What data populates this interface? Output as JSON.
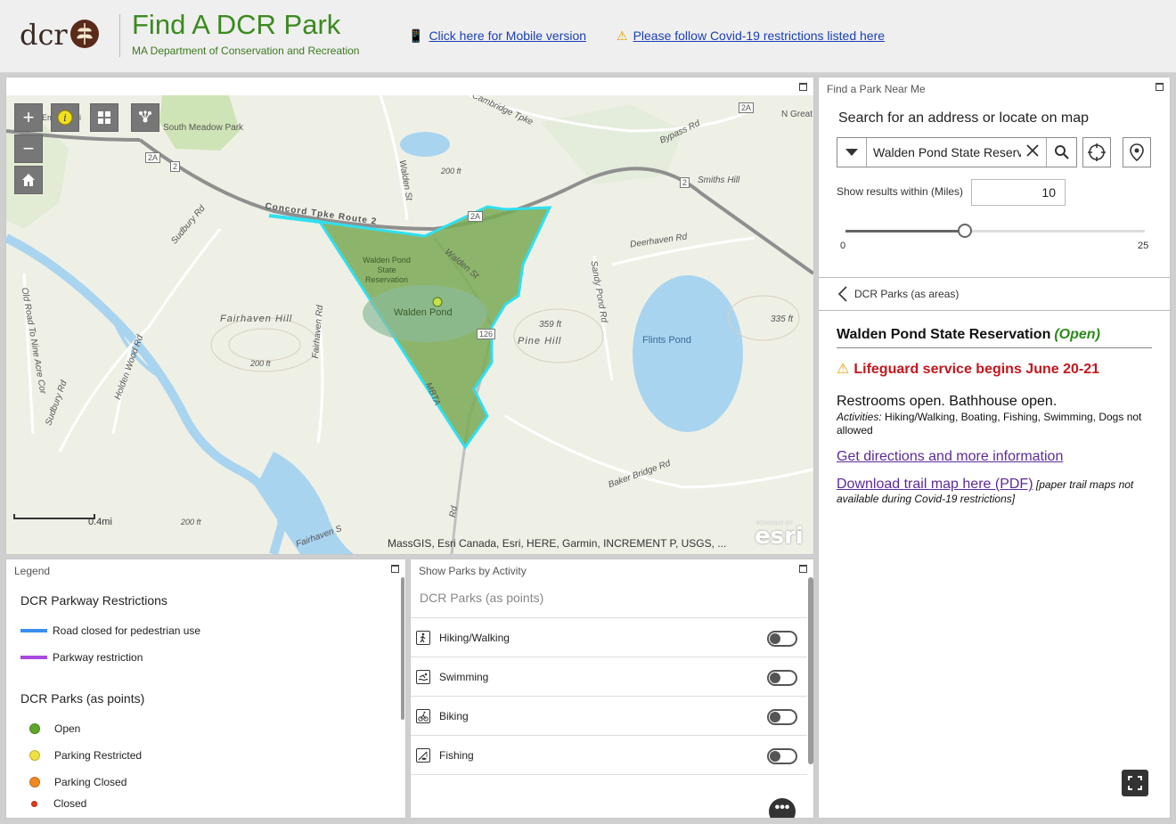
{
  "header": {
    "logo_text": "dcr",
    "title": "Find A DCR Park",
    "subtitle": "MA Department of Conservation and Recreation",
    "mobile_link": "Click here for Mobile version",
    "covid_link": "Please follow Covid-19 restrictions listed here",
    "mobile_icon": "mobile-phone-icon",
    "warning_icon": "warning-icon"
  },
  "map": {
    "labels": {
      "south_meadow": "South Meadow Park",
      "emerson": "Eme Hospi",
      "cambridge": "Cambridge Tpke",
      "bypass": "Bypass Rd",
      "n_great": "N Great",
      "walden_st_n": "Walden St",
      "concord_tpke": "Concord Tpke Route 2",
      "smiths_hill": "Smiths Hill",
      "deerhaven": "Deerhaven Rd",
      "sudbury_n": "Sudbury Rd",
      "sudbury_s": "Sudbury Rd",
      "old_road": "Old Road To Nine Acre Cor",
      "fairhaven_hill": "Fairhaven Hill",
      "fairhaven_rd": "Fairhaven Rd",
      "holden_wood": "Holden Wood Rd",
      "walden_res": "Walden Pond State Reservation",
      "walden_pond": "Walden Pond",
      "walden_st_s": "Walden St",
      "mbta": "MBTA",
      "pine_hill": "Pine Hill",
      "sandy_pond": "Sandy Pond Rd",
      "flints_pond": "Flints Pond",
      "elev_359": "359 ft",
      "elev_335": "335 ft",
      "elev_200a": "200 ft",
      "elev_200b": "200 ft",
      "elev_200c": "200 ft",
      "baker_bridge": "Baker Bridge Rd",
      "fairhaven_s": "Fairhaven S",
      "rd_s": "Rd",
      "route_2a_a": "2A",
      "route_2a_b": "2A",
      "route_2a_c": "2A",
      "route_2_a": "2",
      "route_2_b": "2",
      "route_126": "126"
    },
    "attribution": "MassGIS, Esri Canada, Esri, HERE, Garmin, INCREMENT P, USGS, ...",
    "scale_label": "0.4mi",
    "esri_powered": "POWERED BY",
    "esri": "esri",
    "zoom_in": "+",
    "zoom_out": "−",
    "accent_boundary": "#2fe0f0",
    "park_fill": "#7aaa55"
  },
  "find_panel": {
    "title": "Find a Park Near Me",
    "search_heading": "Search for an address or locate on map",
    "search_value": "Walden Pond State Reservation",
    "radius_label": "Show results within (Miles)",
    "radius_value": "10",
    "slider_min": "0",
    "slider_max": "25",
    "slider_value": 10,
    "slider_max_value": 25,
    "layer_nav_label": "DCR Parks (as areas)",
    "park": {
      "name": "Walden Pond State Reservation",
      "status": "(Open)",
      "alert": "Lifeguard service begins June 20-21",
      "restrooms": "Restrooms open. Bathhouse open.",
      "activities_label": "Activities:",
      "activities": "Hiking/Walking, Boating, Fishing, Swimming, Dogs not allowed",
      "directions_link": "Get directions and more information",
      "trail_link": "Download trail map here (PDF)",
      "trail_note": "[paper trail maps not available during Covid-19 restrictions]"
    }
  },
  "legend": {
    "title": "Legend",
    "parkway_heading": "DCR Parkway Restrictions",
    "parkway_items": [
      {
        "label": "Road closed for pedestrian use",
        "color": "#3a8ef0"
      },
      {
        "label": "Parkway restriction",
        "color": "#a84ae0"
      }
    ],
    "points_heading": "DCR Parks (as points)",
    "point_items": [
      {
        "label": "Open",
        "color": "#5aa82a"
      },
      {
        "label": "Parking Restricted",
        "color": "#f0e040"
      },
      {
        "label": "Parking Closed",
        "color": "#f08a20"
      },
      {
        "label": "Closed",
        "color": "#e03a1a"
      }
    ]
  },
  "activities_panel": {
    "title": "Show Parks by Activity",
    "heading": "DCR Parks (as points)",
    "items": [
      {
        "label": "Hiking/Walking",
        "icon": "hiking-icon",
        "on": false
      },
      {
        "label": "Swimming",
        "icon": "swimming-icon",
        "on": false
      },
      {
        "label": "Biking",
        "icon": "biking-icon",
        "on": false
      },
      {
        "label": "Fishing",
        "icon": "fishing-icon",
        "on": false
      }
    ],
    "more_label": "•••"
  }
}
